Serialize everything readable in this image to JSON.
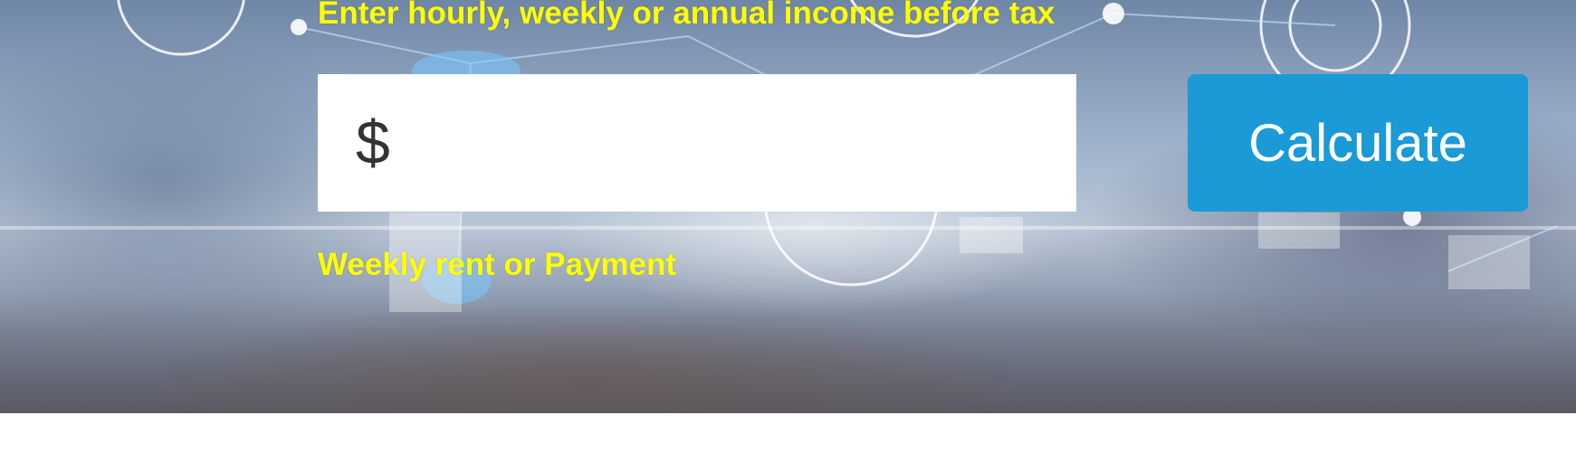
{
  "form": {
    "income_label": "Enter hourly, weekly or annual income before tax",
    "currency_symbol": "$",
    "income_value": "",
    "rent_label": "Weekly rent or Payment",
    "calculate_label": "Calculate"
  },
  "colors": {
    "label": "#ffff00",
    "button": "#1a9ad6",
    "button_text": "#ffffff",
    "input_bg": "#ffffff"
  }
}
